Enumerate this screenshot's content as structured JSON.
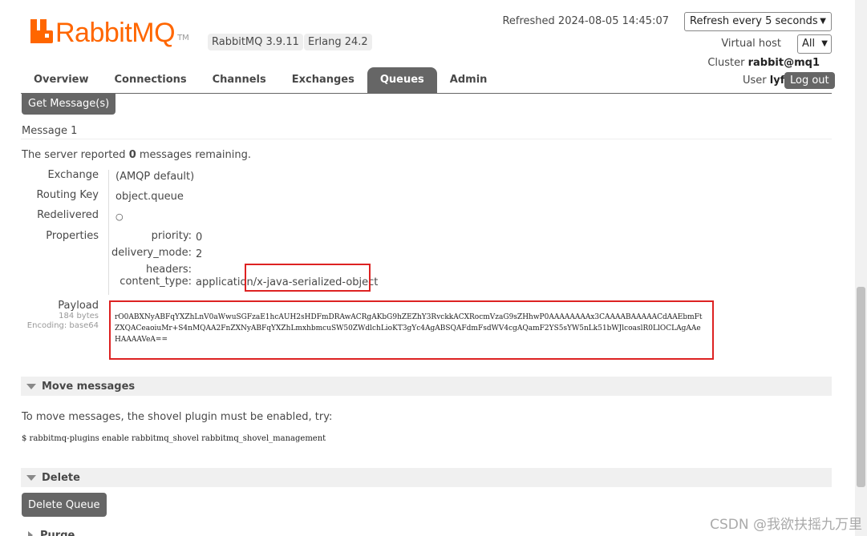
{
  "header": {
    "logo_text": "RabbitMQ",
    "logo_tm": "TM",
    "version_rabbit": "RabbitMQ 3.9.11",
    "version_erlang": "Erlang 24.2",
    "refreshed": "Refreshed 2024-08-05 14:45:07",
    "refresh_option": "Refresh every 5 seconds",
    "vhost_label": "Virtual host",
    "vhost_option": "All",
    "cluster_label": "Cluster",
    "cluster_name": "rabbit@mq1",
    "user_label": "User",
    "user_name": "lyf",
    "logout": "Log out"
  },
  "nav": {
    "items": [
      "Overview",
      "Connections",
      "Channels",
      "Exchanges",
      "Queues",
      "Admin"
    ],
    "active_index": 4
  },
  "get_messages": {
    "button": "Get Message(s)",
    "message_heading": "Message 1",
    "server_reported_pre": "The server reported ",
    "remaining_count": "0",
    "server_reported_post": " messages remaining.",
    "exchange_label": "Exchange",
    "exchange_value": "(AMQP default)",
    "routing_key_label": "Routing Key",
    "routing_key_value": "object.queue",
    "redelivered_label": "Redelivered",
    "redelivered_value": "○",
    "properties_label": "Properties",
    "priority_label": "priority:",
    "priority_value": "0",
    "delivery_mode_label": "delivery_mode:",
    "delivery_mode_value": "2",
    "headers_label": "headers:",
    "content_type_label": "content_type:",
    "content_type_value_a": "application",
    "content_type_value_b": "/x-java-serialized-object",
    "payload_label": "Payload",
    "payload_bytes": "184 bytes",
    "payload_encoding": "Encoding: base64",
    "payload_value": "rO0ABXNyABFqYXZhLnV0aWwuSGFzaE1hcAUH2sHDFmDRAwACRgAKbG9hZEZhY3RvckkACXRocmVzaG9sZHhwP0AAAAAAAAx3CAAAABAAAAACdAAEbmFtZXQACeaoiuMr+S4nMQAA2FnZXNyABFqYXZhLmxhbmcuSW50ZWdlchLioKT3gYc4AgABSQAFdmFsdWV4cgAQamF2YS5sYW5nLk51bWJlcoaslR0LlOCLAgAAeHAAAAVeA=="
  },
  "move_messages": {
    "title": "Move messages",
    "hint": "To move messages, the shovel plugin must be enabled, try:",
    "command": "$ rabbitmq-plugins enable rabbitmq_shovel rabbitmq_shovel_management"
  },
  "delete": {
    "title": "Delete",
    "button": "Delete Queue"
  },
  "purge": {
    "title": "Purge"
  },
  "watermark": "CSDN @我欲扶摇九万里",
  "colors": {
    "brand": "#ff6600",
    "nav_active": "#666666",
    "highlight": "#dd2222"
  }
}
